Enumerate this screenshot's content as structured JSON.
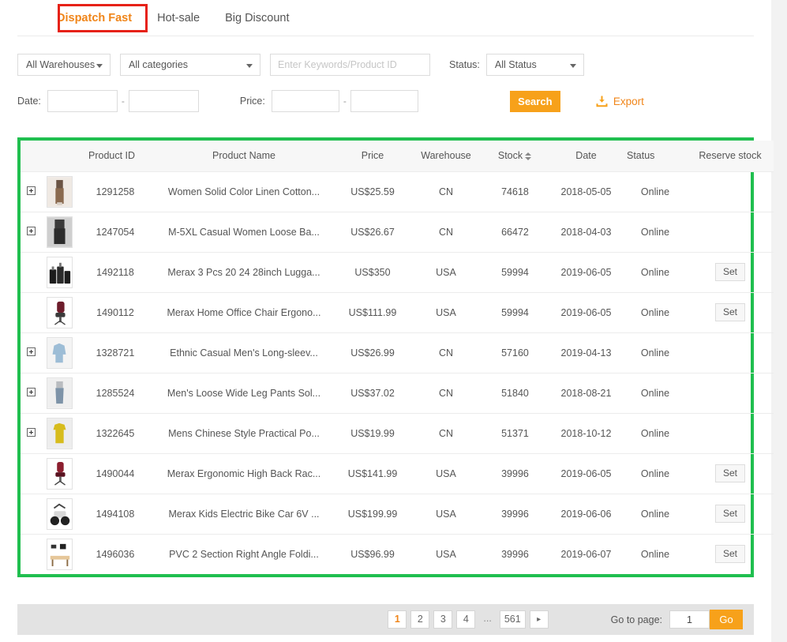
{
  "tabs": [
    {
      "label": "Dispatch Fast",
      "active": true
    },
    {
      "label": "Hot-sale",
      "active": false
    },
    {
      "label": "Big Discount",
      "active": false
    }
  ],
  "filters": {
    "warehouse_select": "All Warehouses",
    "category_select": "All categories",
    "keyword_placeholder": "Enter Keywords/Product ID",
    "keyword_value": "",
    "status_label": "Status:",
    "status_select": "All Status",
    "date_label": "Date:",
    "date_from": "",
    "date_to": "",
    "price_label": "Price:",
    "price_from": "",
    "price_to": "",
    "range_separator": "-",
    "search_button": "Search",
    "export_button": "Export"
  },
  "table": {
    "headers": {
      "product_id": "Product ID",
      "product_name": "Product Name",
      "price": "Price",
      "warehouse": "Warehouse",
      "stock": "Stock",
      "date": "Date",
      "status": "Status",
      "reserve_stock": "Reserve stock"
    },
    "reserve_button_label": "Set",
    "rows": [
      {
        "expandable": true,
        "product_id": "1291258",
        "product_name": "Women Solid Color Linen Cotton...",
        "price": "US$25.59",
        "warehouse": "CN",
        "stock": "74618",
        "date": "2018-05-05",
        "status": "Online",
        "reserve": ""
      },
      {
        "expandable": true,
        "product_id": "1247054",
        "product_name": "M-5XL Casual Women Loose Ba...",
        "price": "US$26.67",
        "warehouse": "CN",
        "stock": "66472",
        "date": "2018-04-03",
        "status": "Online",
        "reserve": ""
      },
      {
        "expandable": false,
        "product_id": "1492118",
        "product_name": "Merax 3 Pcs 20 24 28inch Lugga...",
        "price": "US$350",
        "warehouse": "USA",
        "stock": "59994",
        "date": "2019-06-05",
        "status": "Online",
        "reserve": "Set"
      },
      {
        "expandable": false,
        "product_id": "1490112",
        "product_name": "Merax Home Office Chair Ergono...",
        "price": "US$111.99",
        "warehouse": "USA",
        "stock": "59994",
        "date": "2019-06-05",
        "status": "Online",
        "reserve": "Set"
      },
      {
        "expandable": true,
        "product_id": "1328721",
        "product_name": "Ethnic Casual Men's Long-sleev...",
        "price": "US$26.99",
        "warehouse": "CN",
        "stock": "57160",
        "date": "2019-04-13",
        "status": "Online",
        "reserve": ""
      },
      {
        "expandable": true,
        "product_id": "1285524",
        "product_name": "Men's Loose Wide Leg Pants Sol...",
        "price": "US$37.02",
        "warehouse": "CN",
        "stock": "51840",
        "date": "2018-08-21",
        "status": "Online",
        "reserve": ""
      },
      {
        "expandable": true,
        "product_id": "1322645",
        "product_name": "Mens Chinese Style Practical Po...",
        "price": "US$19.99",
        "warehouse": "CN",
        "stock": "51371",
        "date": "2018-10-12",
        "status": "Online",
        "reserve": ""
      },
      {
        "expandable": false,
        "product_id": "1490044",
        "product_name": "Merax Ergonomic High Back Rac...",
        "price": "US$141.99",
        "warehouse": "USA",
        "stock": "39996",
        "date": "2019-06-05",
        "status": "Online",
        "reserve": "Set"
      },
      {
        "expandable": false,
        "product_id": "1494108",
        "product_name": "Merax Kids Electric Bike Car 6V ...",
        "price": "US$199.99",
        "warehouse": "USA",
        "stock": "39996",
        "date": "2019-06-06",
        "status": "Online",
        "reserve": "Set"
      },
      {
        "expandable": false,
        "product_id": "1496036",
        "product_name": "PVC 2 Section Right Angle Foldi...",
        "price": "US$96.99",
        "warehouse": "USA",
        "stock": "39996",
        "date": "2019-06-07",
        "status": "Online",
        "reserve": "Set"
      }
    ]
  },
  "pagination": {
    "pages": [
      "1",
      "2",
      "3",
      "4"
    ],
    "ellipsis": "...",
    "last_page": "561",
    "next_label": "▸",
    "current_page": "1",
    "goto_label": "Go to page:",
    "goto_value": "1",
    "go_button": "Go"
  },
  "colors": {
    "accent_orange": "#f7a11a",
    "tab_active": "#f08519",
    "highlight_red": "#e62117",
    "table_outline_green": "#20bf4f"
  }
}
